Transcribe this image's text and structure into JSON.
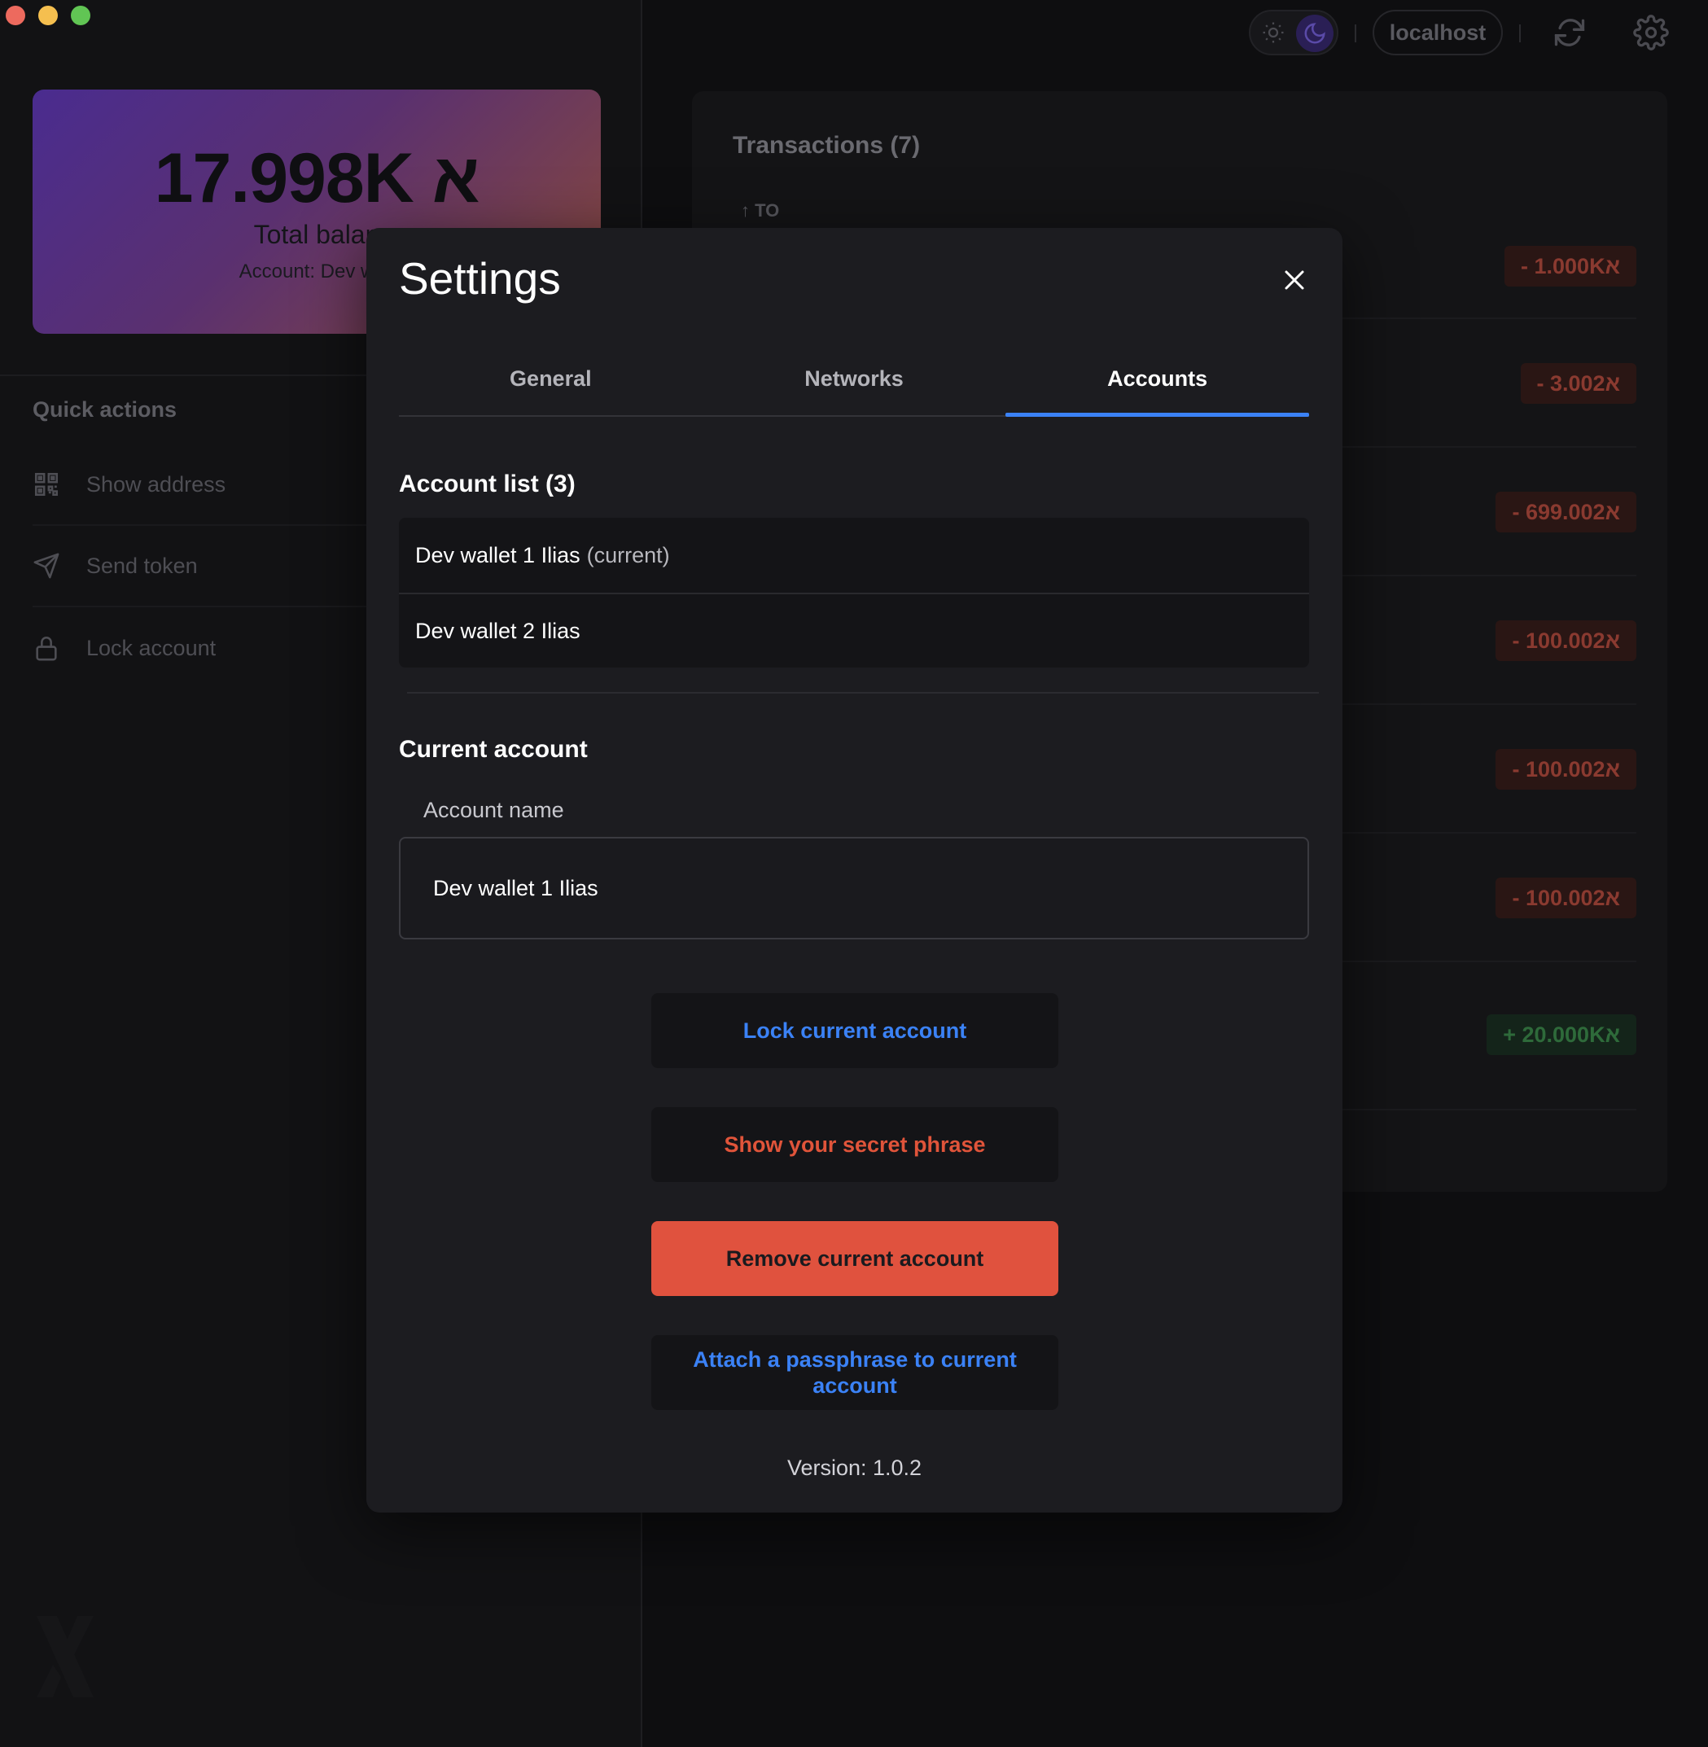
{
  "window": {
    "controls": [
      "close",
      "minimize",
      "maximize"
    ]
  },
  "sidebar": {
    "balance": {
      "amount": "17.998K א",
      "label": "Total balan",
      "account": "Account: Dev wall"
    },
    "quick_actions": {
      "title": "Quick actions",
      "items": [
        {
          "label": "Show address",
          "icon": "qr-code-icon"
        },
        {
          "label": "Send token",
          "icon": "send-icon"
        },
        {
          "label": "Lock account",
          "icon": "lock-icon"
        }
      ]
    }
  },
  "topbar": {
    "network": "localhost",
    "theme": "dark",
    "icons": [
      "sun-icon",
      "moon-icon",
      "refresh-icon",
      "gear-icon"
    ]
  },
  "transactions": {
    "title": "Transactions (7)",
    "direction_label": "↑ TO",
    "amounts": [
      {
        "text": "- 1.000Kא",
        "sign": "neg"
      },
      {
        "text": "- 3.002א",
        "sign": "neg"
      },
      {
        "text": "- 699.002א",
        "sign": "neg"
      },
      {
        "text": "- 100.002א",
        "sign": "neg"
      },
      {
        "text": "- 100.002א",
        "sign": "neg"
      },
      {
        "text": "- 100.002א",
        "sign": "neg"
      },
      {
        "text": "+ 20.000Kא",
        "sign": "pos"
      }
    ]
  },
  "modal": {
    "title": "Settings",
    "tabs": [
      {
        "label": "General",
        "active": false
      },
      {
        "label": "Networks",
        "active": false
      },
      {
        "label": "Accounts",
        "active": true
      }
    ],
    "account_list": {
      "title": "Account list (3)",
      "items": [
        {
          "name": "Dev wallet 1 Ilias",
          "suffix": "(current)"
        },
        {
          "name": "Dev wallet 2 Ilias",
          "suffix": ""
        }
      ]
    },
    "current_account": {
      "title": "Current account",
      "field_label": "Account name",
      "field_value": "Dev wallet 1 Ilias"
    },
    "buttons": {
      "lock": "Lock current account",
      "secret": "Show your secret phrase",
      "remove": "Remove current account",
      "passphrase": "Attach a passphrase to current account"
    },
    "version": "Version: 1.0.2"
  },
  "colors": {
    "accent_blue": "#3b82f6",
    "danger": "#e0523e",
    "background": "#0e0e10",
    "modal_bg": "#1c1c20"
  }
}
